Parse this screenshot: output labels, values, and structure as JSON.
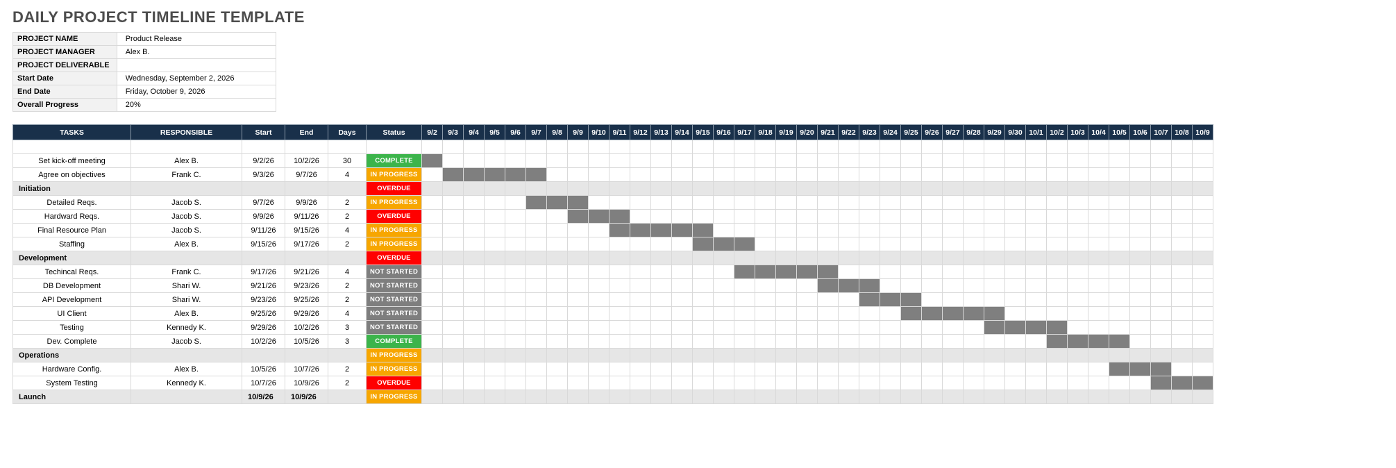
{
  "title": "DAILY PROJECT TIMELINE TEMPLATE",
  "meta": [
    {
      "label": "PROJECT NAME",
      "value": "Product Release"
    },
    {
      "label": "PROJECT MANAGER",
      "value": "Alex B."
    },
    {
      "label": "PROJECT DELIVERABLE",
      "value": ""
    },
    {
      "label": "Start Date",
      "value": "Wednesday, September 2, 2026"
    },
    {
      "label": "End Date",
      "value": "Friday, October 9, 2026"
    },
    {
      "label": "Overall Progress",
      "value": "20%"
    }
  ],
  "headers": {
    "tasks": "TASKS",
    "responsible": "RESPONSIBLE",
    "start": "Start",
    "end": "End",
    "days": "Days",
    "status": "Status"
  },
  "dates": [
    "9/2",
    "9/3",
    "9/4",
    "9/5",
    "9/6",
    "9/7",
    "9/8",
    "9/9",
    "9/10",
    "9/11",
    "9/12",
    "9/13",
    "9/14",
    "9/15",
    "9/16",
    "9/17",
    "9/18",
    "9/19",
    "9/20",
    "9/21",
    "9/22",
    "9/23",
    "9/24",
    "9/25",
    "9/26",
    "9/27",
    "9/28",
    "9/29",
    "9/30",
    "10/1",
    "10/2",
    "10/3",
    "10/4",
    "10/5",
    "10/6",
    "10/7",
    "10/8",
    "10/9"
  ],
  "status_labels": {
    "complete": "COMPLETE",
    "inprogress": "IN PROGRESS",
    "overdue": "OVERDUE",
    "notstarted": "NOT STARTED"
  },
  "rows": [
    {
      "type": "blank"
    },
    {
      "type": "task",
      "task": "Set kick-off meeting",
      "resp": "Alex B.",
      "start": "9/2/26",
      "end": "10/2/26",
      "days": "30",
      "status": "complete",
      "bar": [
        0,
        0
      ]
    },
    {
      "type": "task",
      "task": "Agree on objectives",
      "resp": "Frank C.",
      "start": "9/3/26",
      "end": "9/7/26",
      "days": "4",
      "status": "inprogress",
      "bar": [
        1,
        5
      ]
    },
    {
      "type": "section",
      "task": "Initiation",
      "status": "overdue"
    },
    {
      "type": "task",
      "task": "Detailed Reqs.",
      "resp": "Jacob S.",
      "start": "9/7/26",
      "end": "9/9/26",
      "days": "2",
      "status": "inprogress",
      "bar": [
        5,
        7
      ]
    },
    {
      "type": "task",
      "task": "Hardward Reqs.",
      "resp": "Jacob S.",
      "start": "9/9/26",
      "end": "9/11/26",
      "days": "2",
      "status": "overdue",
      "bar": [
        7,
        9
      ]
    },
    {
      "type": "task",
      "task": "Final Resource Plan",
      "resp": "Jacob S.",
      "start": "9/11/26",
      "end": "9/15/26",
      "days": "4",
      "status": "inprogress",
      "bar": [
        9,
        13
      ]
    },
    {
      "type": "task",
      "task": "Staffing",
      "resp": "Alex B.",
      "start": "9/15/26",
      "end": "9/17/26",
      "days": "2",
      "status": "inprogress",
      "bar": [
        13,
        15
      ]
    },
    {
      "type": "section",
      "task": "Development",
      "status": "overdue"
    },
    {
      "type": "task",
      "task": "Techincal Reqs.",
      "resp": "Frank C.",
      "start": "9/17/26",
      "end": "9/21/26",
      "days": "4",
      "status": "notstarted",
      "bar": [
        15,
        19
      ]
    },
    {
      "type": "task",
      "task": "DB Development",
      "resp": "Shari W.",
      "start": "9/21/26",
      "end": "9/23/26",
      "days": "2",
      "status": "notstarted",
      "bar": [
        19,
        21
      ]
    },
    {
      "type": "task",
      "task": "API Development",
      "resp": "Shari W.",
      "start": "9/23/26",
      "end": "9/25/26",
      "days": "2",
      "status": "notstarted",
      "bar": [
        21,
        23
      ]
    },
    {
      "type": "task",
      "task": "UI Client",
      "resp": "Alex B.",
      "start": "9/25/26",
      "end": "9/29/26",
      "days": "4",
      "status": "notstarted",
      "bar": [
        23,
        27
      ]
    },
    {
      "type": "task",
      "task": "Testing",
      "resp": "Kennedy K.",
      "start": "9/29/26",
      "end": "10/2/26",
      "days": "3",
      "status": "notstarted",
      "bar": [
        27,
        30
      ]
    },
    {
      "type": "task",
      "task": "Dev. Complete",
      "resp": "Jacob S.",
      "start": "10/2/26",
      "end": "10/5/26",
      "days": "3",
      "status": "complete",
      "bar": [
        30,
        33
      ]
    },
    {
      "type": "section",
      "task": "Operations",
      "status": "inprogress"
    },
    {
      "type": "task",
      "task": "Hardware Config.",
      "resp": "Alex B.",
      "start": "10/5/26",
      "end": "10/7/26",
      "days": "2",
      "status": "inprogress",
      "bar": [
        33,
        35
      ]
    },
    {
      "type": "task",
      "task": "System Testing",
      "resp": "Kennedy K.",
      "start": "10/7/26",
      "end": "10/9/26",
      "days": "2",
      "status": "overdue",
      "bar": [
        35,
        37
      ]
    },
    {
      "type": "section",
      "task": "Launch",
      "start": "10/9/26",
      "end": "10/9/26",
      "status": "inprogress"
    }
  ]
}
